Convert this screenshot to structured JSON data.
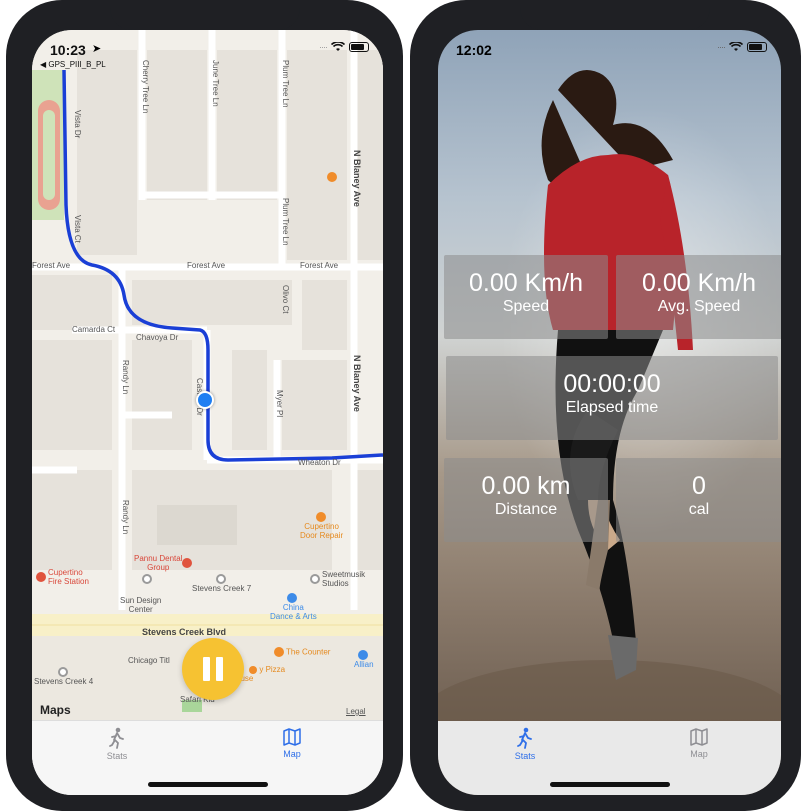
{
  "left_phone": {
    "status": {
      "time": "10:23",
      "back_label": "◀ GPS_PIII_B_PL"
    },
    "map": {
      "streets": {
        "forest_ave_left": "Forest Ave",
        "forest_ave_mid": "Forest Ave",
        "forest_ave_right": "Forest Ave",
        "camarda_ct": "Camarda Ct",
        "chavoya_dr": "Chavoya Dr",
        "randy_ln_top": "Randy Ln",
        "randy_ln_bottom": "Randy Ln",
        "n_blaney_ave_top": "N Blaney Ave",
        "n_blaney_ave_mid": "N Blaney Ave",
        "wheaton_dr": "Wheaton Dr",
        "stevens_creek_blvd": "Stevens Creek Blvd",
        "vista_dr": "Vista Dr",
        "vista_ct": "Vista Ct",
        "plum_tree_ln": "Plum Tree Ln",
        "myer_pl": "Myer Pl",
        "olivo_ct": "Olivo Ct",
        "castine_dr": "Castine Dr",
        "cherry_tree_ln": "Cherry Tree Ln",
        "plum_tree_ln_top": "Plum Tree Ln",
        "june_tree_ln": "June Tree Ln"
      },
      "pois": {
        "cupertino_fire": "Cupertino\nFire Station",
        "pannu_dental": "Pannu Dental\nGroup",
        "stevens_creek_7": "Stevens Creek 7",
        "sun_design": "Sun Design\nCenter",
        "china_dance": "China\nDance & Arts",
        "sweetmusik": "Sweetmusik\nStudios",
        "cupertino_door": "Cupertino\nDoor Repair",
        "chicago_title": "Chicago Titl",
        "pizza_house": "y Pizza\nouse",
        "the_counter": "The Counter",
        "stevens_creek_4": "Stevens Creek 4",
        "safari_kid": "Safari Kid",
        "alliance": "Allian"
      },
      "maps_logo": "Maps",
      "legal": "Legal",
      "colors": {
        "route": "#1a3fd6",
        "pause": "#f6c232",
        "poi_red": "#e0533d",
        "poi_orange": "#f08c2a",
        "poi_blue": "#3d8be8",
        "poi_gray": "#9a9a9a"
      }
    },
    "tabs": [
      {
        "label": "Stats",
        "icon": "walking-figure-icon",
        "active": false
      },
      {
        "label": "Map",
        "icon": "map-icon",
        "active": true
      }
    ]
  },
  "right_phone": {
    "status": {
      "time": "12:02"
    },
    "stats": {
      "speed": {
        "value": "0.00  Km/h",
        "label": "Speed"
      },
      "avg_speed": {
        "value": "0.00  Km/h",
        "label": "Avg. Speed"
      },
      "elapsed": {
        "value": "00:00:00",
        "label": "Elapsed time"
      },
      "distance": {
        "value": "0.00  km",
        "label": "Distance"
      },
      "calories": {
        "value": "0",
        "label": "cal"
      }
    },
    "tabs": [
      {
        "label": "Stats",
        "icon": "walking-figure-icon",
        "active": true
      },
      {
        "label": "Map",
        "icon": "map-icon",
        "active": false
      }
    ],
    "colors": {
      "active_tab": "#2f6fe8",
      "inactive_tab": "#8e8e93"
    }
  }
}
